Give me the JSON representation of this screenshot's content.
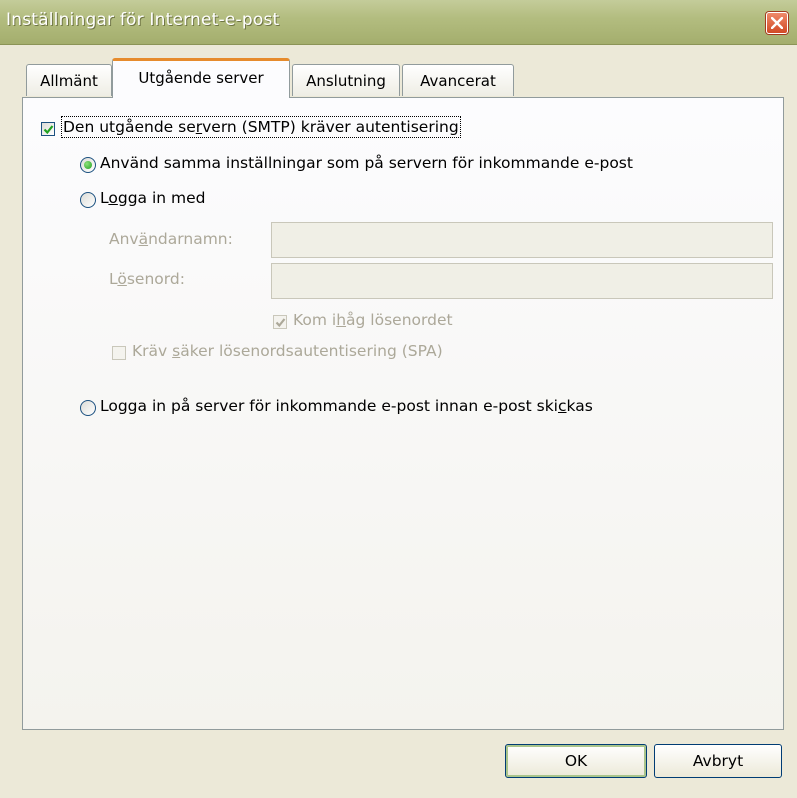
{
  "window": {
    "title": "Inställningar för Internet-e-post",
    "close_icon": "close-icon"
  },
  "tabs": [
    {
      "label": "Allmänt",
      "active": false
    },
    {
      "label": "Utgående server",
      "active": true
    },
    {
      "label": "Anslutning",
      "active": false
    },
    {
      "label": "Avancerat",
      "active": false
    }
  ],
  "smtp_auth": {
    "pre": "Den utgående se",
    "key": "r",
    "post": "vern (SMTP) kräver autentisering",
    "checked": true
  },
  "option_same": {
    "label": "Använd samma inställningar som på servern för inkommande e-post",
    "selected": true
  },
  "option_login": {
    "pre": "L",
    "key": "o",
    "post": "gga in med",
    "selected": false
  },
  "username": {
    "pre": "Anv",
    "key": "ä",
    "post": "ndarnamn:",
    "value": ""
  },
  "password": {
    "pre": "L",
    "key": "ö",
    "post": "senord:",
    "value": ""
  },
  "remember": {
    "pre": "Kom i",
    "key": "h",
    "post": "åg lösenordet",
    "checked": true,
    "disabled": true
  },
  "spa": {
    "pre": "Kräv ",
    "key": "s",
    "post": "äker lösenordsautentisering (SPA)",
    "checked": false,
    "disabled": true
  },
  "option_incoming_first": {
    "pre": "Logga in på server för inkommande e-post innan e-post ski",
    "key": "c",
    "post": "kas",
    "selected": false
  },
  "buttons": {
    "ok": "OK",
    "cancel": "Avbryt"
  },
  "colors": {
    "titlebar": "#b3bd80",
    "tab_highlight": "#e68b2c",
    "check": "#21a121",
    "disabled_text": "#aca899"
  }
}
